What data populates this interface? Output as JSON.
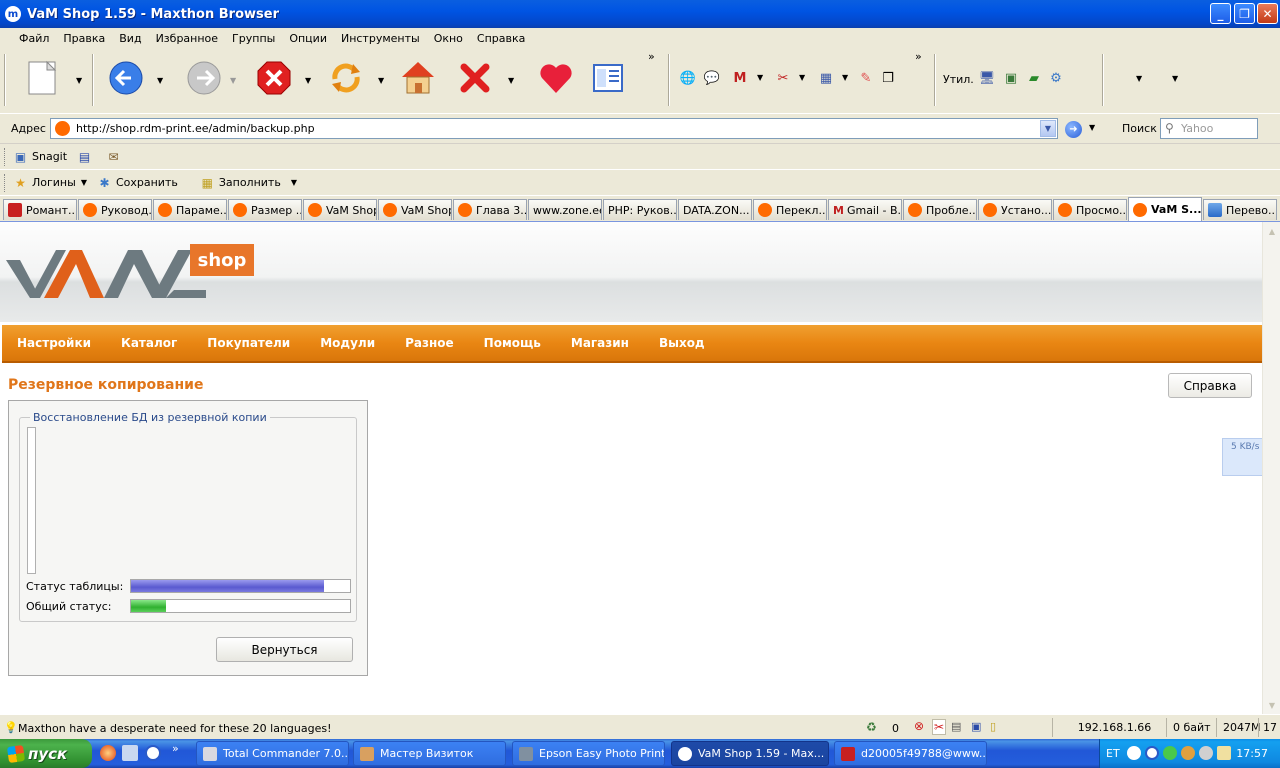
{
  "window": {
    "title": "VaM Shop 1.59 - Maxthon Browser"
  },
  "menu": [
    "Файл",
    "Правка",
    "Вид",
    "Избранное",
    "Группы",
    "Опции",
    "Инструменты",
    "Окно",
    "Справка"
  ],
  "toolbar": {
    "util_label": "Утил."
  },
  "address": {
    "label": "Адрес",
    "url": "http://shop.rdm-print.ee/admin/backup.php",
    "search_label": "Поиск",
    "search_placeholder": "Yahoo"
  },
  "linkbar1": {
    "items": [
      "Snagit"
    ]
  },
  "linkbar2": {
    "items": [
      "Логины",
      "Сохранить",
      "Заполнить"
    ]
  },
  "tabs": [
    "Романт...",
    "Руковод...",
    "Параме...",
    "Размер ...",
    "VaM Shop",
    "VaM Shop",
    "Глава 3...",
    "www.zone.ee",
    "PHP: Руков...",
    "DATA.ZON...",
    "Перекл...",
    "Gmail - В...",
    "Пробле...",
    "Устано...",
    "Просмо...",
    "VaM S...",
    "Перево..."
  ],
  "logo": {
    "shop_label": "shop"
  },
  "nav": [
    "Настройки",
    "Каталог",
    "Покупатели",
    "Модули",
    "Разное",
    "Помощь",
    "Магазин",
    "Выход"
  ],
  "page": {
    "title": "Резервное копирование",
    "help_button": "Справка",
    "legend": "Восстановление БД из резервной копии",
    "table_status_label": "Статус таблицы:",
    "total_status_label": "Общий статус:",
    "table_status_progress": 0.88,
    "total_status_progress": 0.16,
    "back_button": "Вернуться",
    "speed": "5 KB/s"
  },
  "status": {
    "message": "Maxthon have a desperate need for these 20 languages!",
    "count": "0",
    "ip": "192.168.1.66",
    "bytes": "0 байт",
    "memory": "2047M",
    "extra": "17"
  },
  "taskbar": {
    "start": "пуск",
    "tasks": [
      "Total Commander 7.0...",
      "Мастер Визиток",
      "Epson Easy Photo Print",
      "VaM Shop 1.59 - Max...",
      "d20005f49788@www...."
    ],
    "lang": "ET",
    "clock": "17:57"
  },
  "colors": {
    "accent": "#e98613",
    "title_orange": "#e0761a",
    "progress_table": "#6a6ad8",
    "progress_total": "#3cc03c"
  }
}
